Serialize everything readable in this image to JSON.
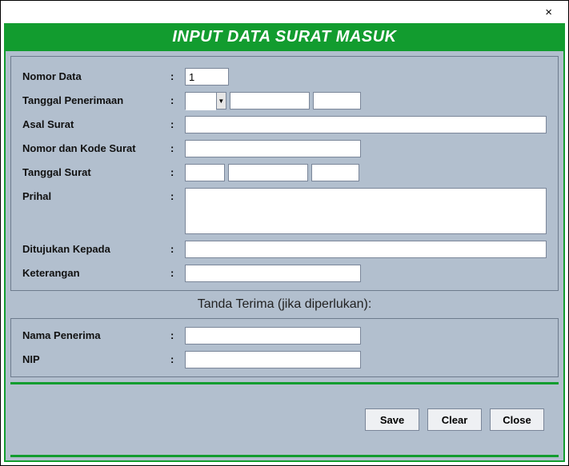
{
  "window": {
    "title_hidden": "",
    "close_icon": "×"
  },
  "header": {
    "title": "INPUT DATA SURAT MASUK"
  },
  "form": {
    "nomor_data": {
      "label": "Nomor Data",
      "value": "1"
    },
    "tanggal_penerimaan": {
      "label": "Tanggal Penerimaan",
      "day": "",
      "month": "",
      "year": ""
    },
    "asal_surat": {
      "label": "Asal Surat",
      "value": ""
    },
    "nomor_kode_surat": {
      "label": "Nomor dan Kode Surat",
      "value": ""
    },
    "tanggal_surat": {
      "label": "Tanggal Surat",
      "day": "",
      "month": "",
      "year": ""
    },
    "prihal": {
      "label": "Prihal",
      "value": ""
    },
    "ditujukan_kepada": {
      "label": "Ditujukan Kepada",
      "value": ""
    },
    "keterangan": {
      "label": "Keterangan",
      "value": ""
    }
  },
  "receipt": {
    "heading": "Tanda Terima (jika diperlukan):",
    "nama_penerima": {
      "label": "Nama Penerima",
      "value": ""
    },
    "nip": {
      "label": "NIP",
      "value": ""
    }
  },
  "buttons": {
    "save": "Save",
    "clear": "Clear",
    "close": "Close"
  }
}
